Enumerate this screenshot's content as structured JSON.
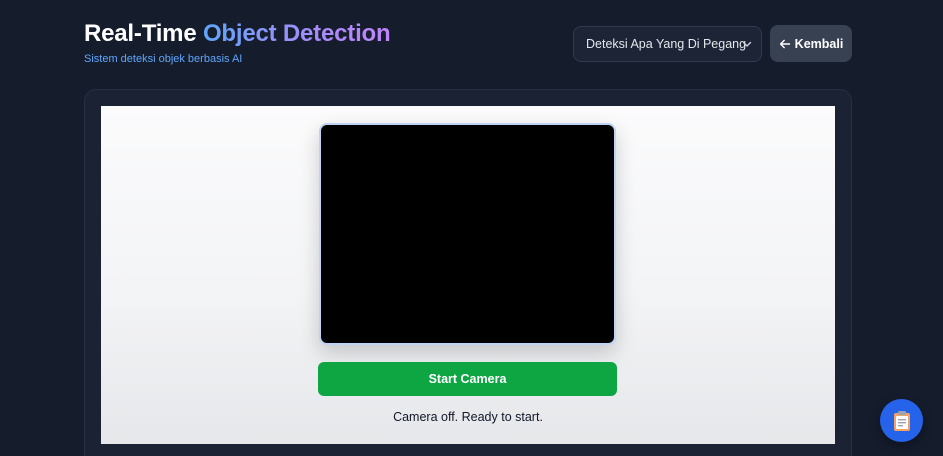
{
  "header": {
    "title_plain": "Real-Time ",
    "title_highlight": "Object Detection",
    "subtitle": "Sistem deteksi objek berbasis AI"
  },
  "mode_select": {
    "selected": "Deteksi Apa Yang Di Pegang",
    "icon": "chevron-down-icon"
  },
  "back_button": {
    "label": "Kembali",
    "icon": "arrow-left-icon"
  },
  "camera": {
    "start_label": "Start Camera",
    "status": "Camera off. Ready to start."
  },
  "fab": {
    "icon": "clipboard-icon"
  },
  "colors": {
    "background": "#151c2c",
    "accent_blue": "#60a5fa",
    "accent_purple": "#c084fc",
    "start_green": "#0ea543",
    "fab_blue": "#2563eb"
  }
}
